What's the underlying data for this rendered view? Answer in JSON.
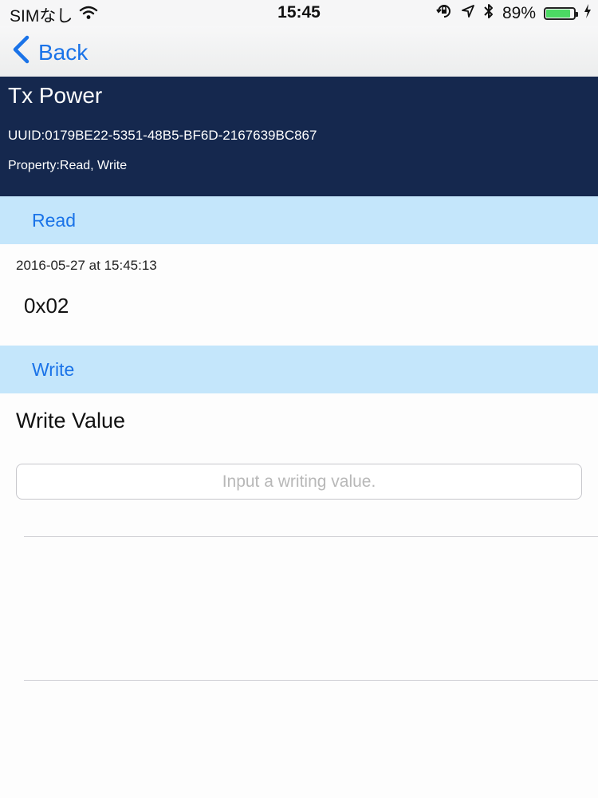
{
  "status_bar": {
    "carrier": "SIMなし",
    "time": "15:45",
    "battery_percent": "89%",
    "battery_level": 0.89,
    "icons": [
      "wifi-icon",
      "rotation-lock-icon",
      "location-arrow-icon",
      "bluetooth-icon",
      "battery-icon",
      "charging-bolt-icon"
    ]
  },
  "nav": {
    "back_label": "Back"
  },
  "characteristic": {
    "name": "Tx Power",
    "uuid": "UUID:0179BE22-5351-48B5-BF6D-2167639BC867",
    "property": "Property:Read, Write"
  },
  "read_section": {
    "header": "Read",
    "timestamp": "2016-05-27 at 15:45:13",
    "value": "0x02"
  },
  "write_section": {
    "header": "Write",
    "label": "Write Value",
    "input_value": "",
    "input_placeholder": "Input a writing value."
  },
  "colors": {
    "accent": "#1a73e8",
    "header_bg": "#15284e",
    "section_bg": "#c4e6fb",
    "battery_fill": "#4cd964"
  }
}
